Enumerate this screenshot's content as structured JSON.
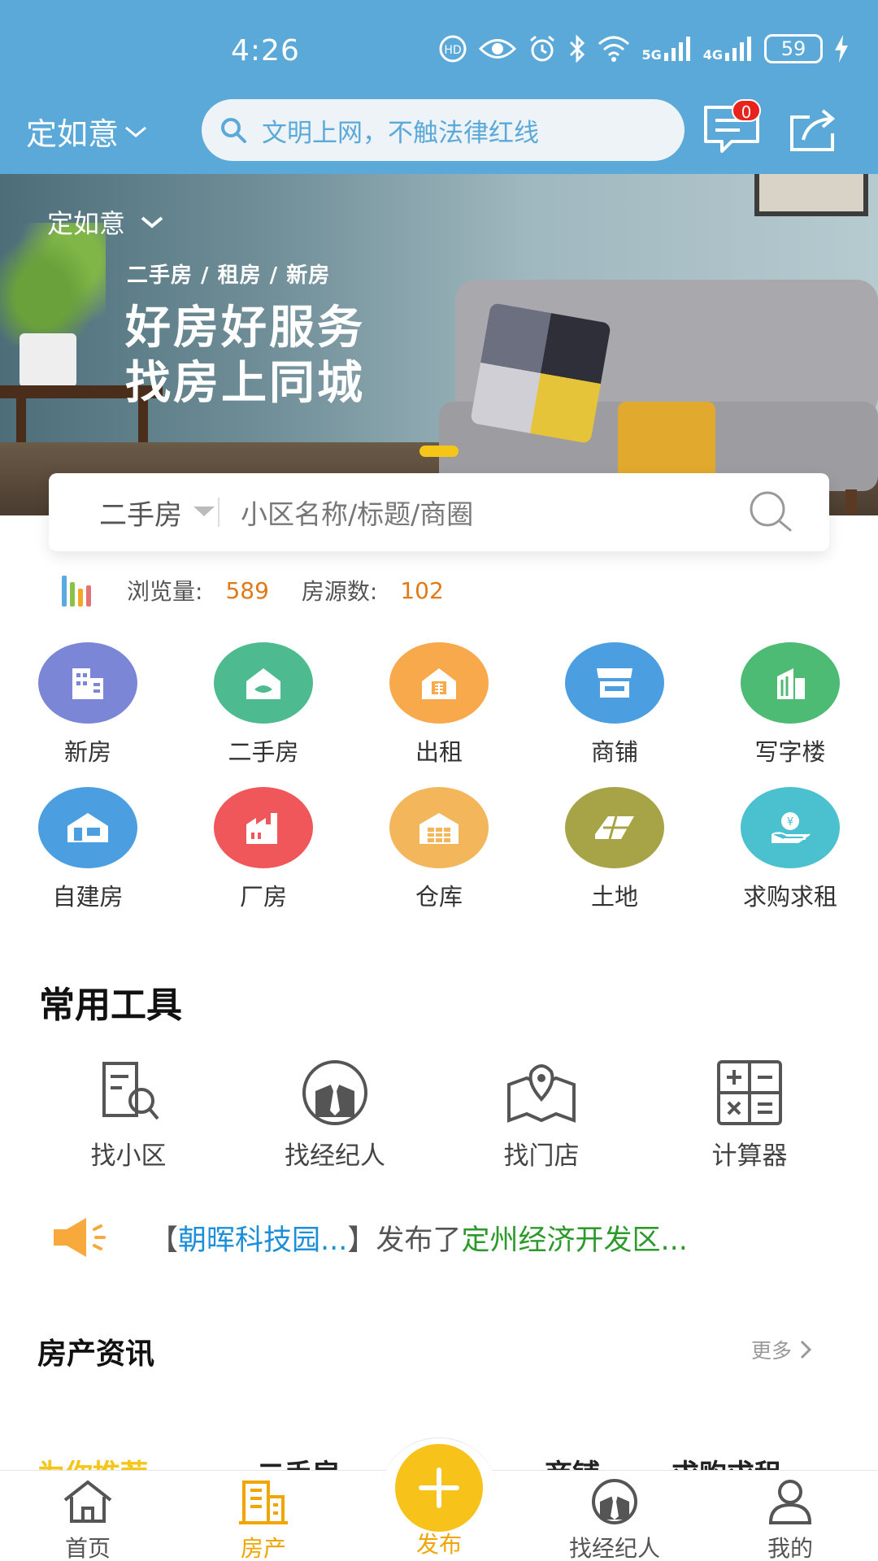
{
  "status_bar": {
    "time": "4:26",
    "network_1": "5G",
    "network_2": "4G",
    "battery": "59"
  },
  "header": {
    "city": "定如意",
    "search_placeholder": "文明上网，不触法律红线",
    "message_count": "0"
  },
  "banner": {
    "city": "定如意",
    "tags": "二手房 / 租房 / 新房",
    "line1": "好房好服务",
    "line2": "找房上同城"
  },
  "house_search": {
    "type": "二手房",
    "placeholder": "小区名称/标题/商圈"
  },
  "stats": {
    "views_label": "浏览量:",
    "views": "589",
    "listings_label": "房源数:",
    "listings": "102"
  },
  "categories": [
    {
      "label": "新房",
      "icon": "building-icon",
      "color": "#7b86d6"
    },
    {
      "label": "二手房",
      "icon": "house-handshake-icon",
      "color": "#4dbb8f"
    },
    {
      "label": "出租",
      "icon": "rent-house-icon",
      "color": "#f7a94b"
    },
    {
      "label": "商铺",
      "icon": "shop-icon",
      "color": "#4b9fe0"
    },
    {
      "label": "写字楼",
      "icon": "office-building-icon",
      "color": "#4dbb74"
    },
    {
      "label": "自建房",
      "icon": "self-built-house-icon",
      "color": "#4b9fe0"
    },
    {
      "label": "厂房",
      "icon": "factory-icon",
      "color": "#f0575a"
    },
    {
      "label": "仓库",
      "icon": "warehouse-icon",
      "color": "#f3b65b"
    },
    {
      "label": "土地",
      "icon": "land-icon",
      "color": "#a6a446"
    },
    {
      "label": "求购求租",
      "icon": "money-hand-icon",
      "color": "#4bc0cf"
    }
  ],
  "tools": {
    "title": "常用工具",
    "items": [
      {
        "label": "找小区",
        "icon": "find-community-icon"
      },
      {
        "label": "找经纪人",
        "icon": "agent-icon"
      },
      {
        "label": "找门店",
        "icon": "map-pin-icon"
      },
      {
        "label": "计算器",
        "icon": "calculator-icon"
      }
    ]
  },
  "notice": {
    "open_bracket": "【",
    "source": "朝晖科技园...",
    "close_bracket": "】",
    "action": "发布了",
    "target": "定州经济开发区..."
  },
  "news": {
    "title": "房产资讯",
    "more": "更多"
  },
  "tabs_peek": [
    "为你推荐",
    "二手房",
    "商铺",
    "求购求租"
  ],
  "bottom_nav": [
    {
      "label": "首页",
      "icon": "home-icon"
    },
    {
      "label": "房产",
      "icon": "property-icon"
    },
    {
      "label": "发布",
      "icon": "plus-icon"
    },
    {
      "label": "找经纪人",
      "icon": "agent-icon"
    },
    {
      "label": "我的",
      "icon": "user-icon"
    }
  ]
}
